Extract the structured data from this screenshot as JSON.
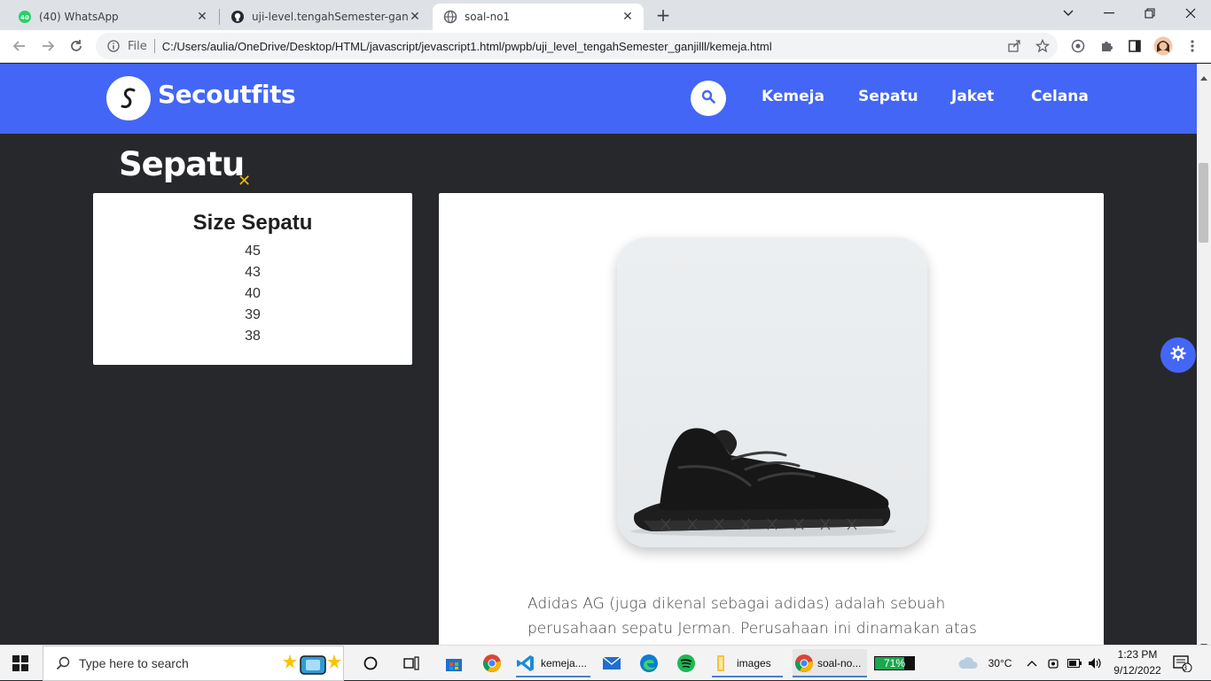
{
  "browser": {
    "tabs": [
      {
        "title": "(40) WhatsApp",
        "badge": "40",
        "icon": "whatsapp-icon"
      },
      {
        "title": "uji-level.tengahSemester-ganjil/u",
        "icon": "github-icon"
      },
      {
        "title": "soal-no1",
        "icon": "globe-icon"
      }
    ],
    "address": {
      "scheme_label": "File",
      "url": "C:/Users/aulia/OneDrive/Desktop/HTML/javascript/jevascript1.html/pwpb/uji_level_tengahSemester_ganjilll/kemeja.html"
    }
  },
  "site": {
    "brand": "Secoutfits",
    "nav": [
      "Kemeja",
      "Sepatu",
      "Jaket",
      "Celana"
    ],
    "accent": "#4366f6",
    "page_bg": "#27282c"
  },
  "page": {
    "heading": "Sepatu",
    "sizes": {
      "title": "Size Sepatu",
      "items": [
        "45",
        "43",
        "40",
        "39",
        "38"
      ]
    },
    "product": {
      "image_icon": "sneaker-image",
      "description": "Adidas AG (juga dikenal sebagai adidas) adalah sebuah perusahaan sepatu Jerman. Perusahaan ini dinamakan atas"
    }
  },
  "taskbar": {
    "search_placeholder": "Type here to search",
    "apps": [
      {
        "label": "kemeja....",
        "icon": "vscode-icon"
      },
      {
        "label": "images",
        "icon": "folder-icon"
      },
      {
        "label": "soal-no...",
        "icon": "chrome-icon"
      }
    ],
    "battery": "71%",
    "temperature": "30°C",
    "time": "1:23 PM",
    "date": "9/12/2022",
    "notifications": "3"
  }
}
